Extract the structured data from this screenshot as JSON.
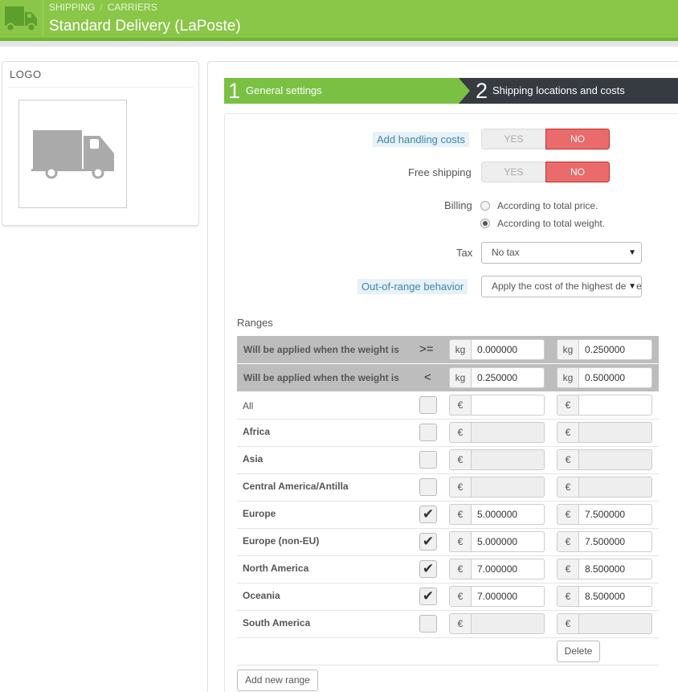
{
  "header": {
    "breadcrumb": [
      "SHIPPING",
      "CARRIERS"
    ],
    "breadcrumb_sep": "/",
    "title": "Standard Delivery (LaPoste)",
    "icon": "truck-icon"
  },
  "logo_panel": {
    "title": "LOGO",
    "image_icon": "truck-icon"
  },
  "steps": [
    {
      "number": "1",
      "label": "General settings",
      "state": "done"
    },
    {
      "number": "2",
      "label": "Shipping locations and costs",
      "state": "active"
    }
  ],
  "form": {
    "handling": {
      "label": "Add handling costs",
      "yes": "YES",
      "no": "NO",
      "value": "NO"
    },
    "free_shipping": {
      "label": "Free shipping",
      "yes": "YES",
      "no": "NO",
      "value": "NO"
    },
    "billing": {
      "label": "Billing",
      "options": [
        {
          "label": "According to total price.",
          "checked": false
        },
        {
          "label": "According to total weight.",
          "checked": true
        }
      ]
    },
    "tax": {
      "label": "Tax",
      "value": "No tax"
    },
    "out_of_range": {
      "label": "Out-of-range behavior",
      "value": "Apply the cost of the highest defined range"
    }
  },
  "ranges": {
    "title": "Ranges",
    "head": [
      {
        "text": "Will be applied when the weight is",
        "op": ">=",
        "unit": "kg",
        "values": [
          "0.000000",
          "0.250000"
        ]
      },
      {
        "text": "Will be applied when the weight is",
        "op": "<",
        "unit": "kg",
        "values": [
          "0.250000",
          "0.500000"
        ]
      }
    ],
    "currency": "€",
    "zones": [
      {
        "name": "All",
        "checked": false,
        "values": [
          "",
          ""
        ],
        "enabled": true,
        "bold": false
      },
      {
        "name": "Africa",
        "checked": false,
        "values": [
          "",
          ""
        ],
        "enabled": false,
        "bold": true
      },
      {
        "name": "Asia",
        "checked": false,
        "values": [
          "",
          ""
        ],
        "enabled": false,
        "bold": true
      },
      {
        "name": "Central America/Antilla",
        "checked": false,
        "values": [
          "",
          ""
        ],
        "enabled": false,
        "bold": true
      },
      {
        "name": "Europe",
        "checked": true,
        "values": [
          "5.000000",
          "7.500000"
        ],
        "enabled": true,
        "bold": true
      },
      {
        "name": "Europe (non-EU)",
        "checked": true,
        "values": [
          "5.000000",
          "7.500000"
        ],
        "enabled": true,
        "bold": true
      },
      {
        "name": "North America",
        "checked": true,
        "values": [
          "7.000000",
          "8.500000"
        ],
        "enabled": true,
        "bold": true
      },
      {
        "name": "Oceania",
        "checked": true,
        "values": [
          "7.000000",
          "8.500000"
        ],
        "enabled": true,
        "bold": true
      },
      {
        "name": "South America",
        "checked": false,
        "values": [
          "",
          ""
        ],
        "enabled": false,
        "bold": true
      }
    ],
    "delete_label": "Delete",
    "add_label": "Add new range"
  },
  "colors": {
    "header_green": "#8ac648",
    "step_done": "#7ac143",
    "step_active": "#363a41",
    "switch_no": "#e96b6b"
  }
}
